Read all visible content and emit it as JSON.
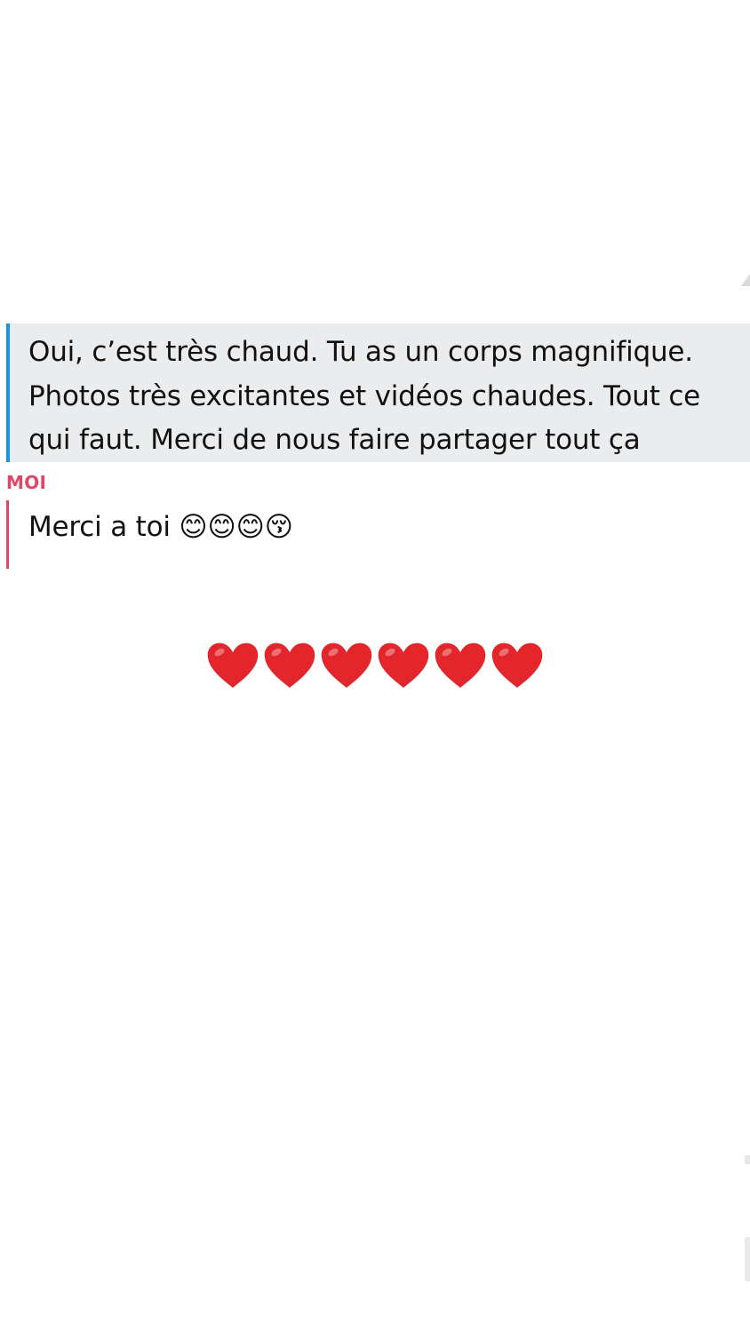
{
  "chat": {
    "friend_message": {
      "text": "Oui, c’est très chaud. Tu as un corps magnifique.\nPhotos très excitantes et vidéos chaudes. Tout ce qui faut. Merci de nous faire partager tout ça",
      "accent_color": "#1596e2"
    },
    "my_message": {
      "sender_label": "MOI",
      "text": "Merci a toi 😊😊😊😚",
      "accent_color": "#e0466a"
    },
    "hearts": {
      "emoji": "heart-emoji",
      "count": 6,
      "color": "#e2262c"
    }
  }
}
